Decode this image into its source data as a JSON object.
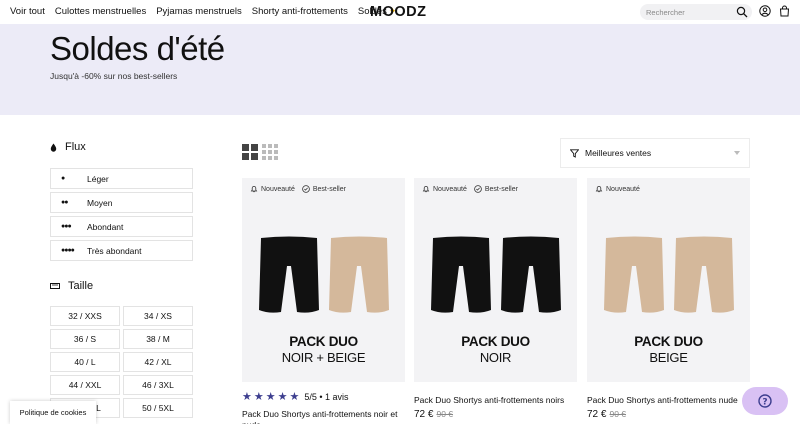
{
  "header": {
    "nav": [
      "Voir tout",
      "Culottes menstruelles",
      "Pyjamas menstruels",
      "Shorty anti-frottements",
      "Soldes"
    ],
    "logo": "MOODZ",
    "search_placeholder": "Rechercher",
    "icons": [
      "search-icon",
      "user-icon",
      "cart-icon"
    ]
  },
  "hero": {
    "title": "Soldes d'été",
    "subtitle": "Jusqu'à -60% sur nos best-sellers",
    "background": "#ecebf7"
  },
  "filters": {
    "flux": {
      "title": "Flux",
      "options": [
        {
          "label": "Léger",
          "drops": 1
        },
        {
          "label": "Moyen",
          "drops": 2
        },
        {
          "label": "Abondant",
          "drops": 3
        },
        {
          "label": "Très abondant",
          "drops": 4
        }
      ]
    },
    "taille": {
      "title": "Taille",
      "options": [
        "32 / XXS",
        "34 / XS",
        "36 / S",
        "38 / M",
        "40 / L",
        "42 / XL",
        "44 / XXL",
        "46 / 3XL",
        "48 / 4XL",
        "50 / 5XL"
      ]
    }
  },
  "toolbar": {
    "sort_label": "Meilleures ventes"
  },
  "products": [
    {
      "badges": [
        "Nouveauté",
        "Best-seller"
      ],
      "pack_title": "PACK DUO",
      "pack_sub": "NOIR + BEIGE",
      "colors": [
        "#111111",
        "#d4b89b"
      ],
      "rating": {
        "stars": 5,
        "text": "5/5 • 1 avis"
      },
      "name": "Pack Duo Shortys anti-frottements noir et nude",
      "price": "",
      "old_price": ""
    },
    {
      "badges": [
        "Nouveauté",
        "Best-seller"
      ],
      "pack_title": "PACK DUO",
      "pack_sub": "NOIR",
      "colors": [
        "#111111",
        "#111111"
      ],
      "name": "Pack Duo Shortys anti-frottements noirs",
      "price": "72 €",
      "old_price": "90 €"
    },
    {
      "badges": [
        "Nouveauté"
      ],
      "pack_title": "PACK DUO",
      "pack_sub": "BEIGE",
      "colors": [
        "#d4b89b",
        "#d4b89b"
      ],
      "name": "Pack Duo Shortys anti-frottements nude",
      "price": "72 €",
      "old_price": "90 €"
    }
  ],
  "cookie_label": "Politique de cookies",
  "help_label": "?",
  "accent": "#3d3e8f"
}
